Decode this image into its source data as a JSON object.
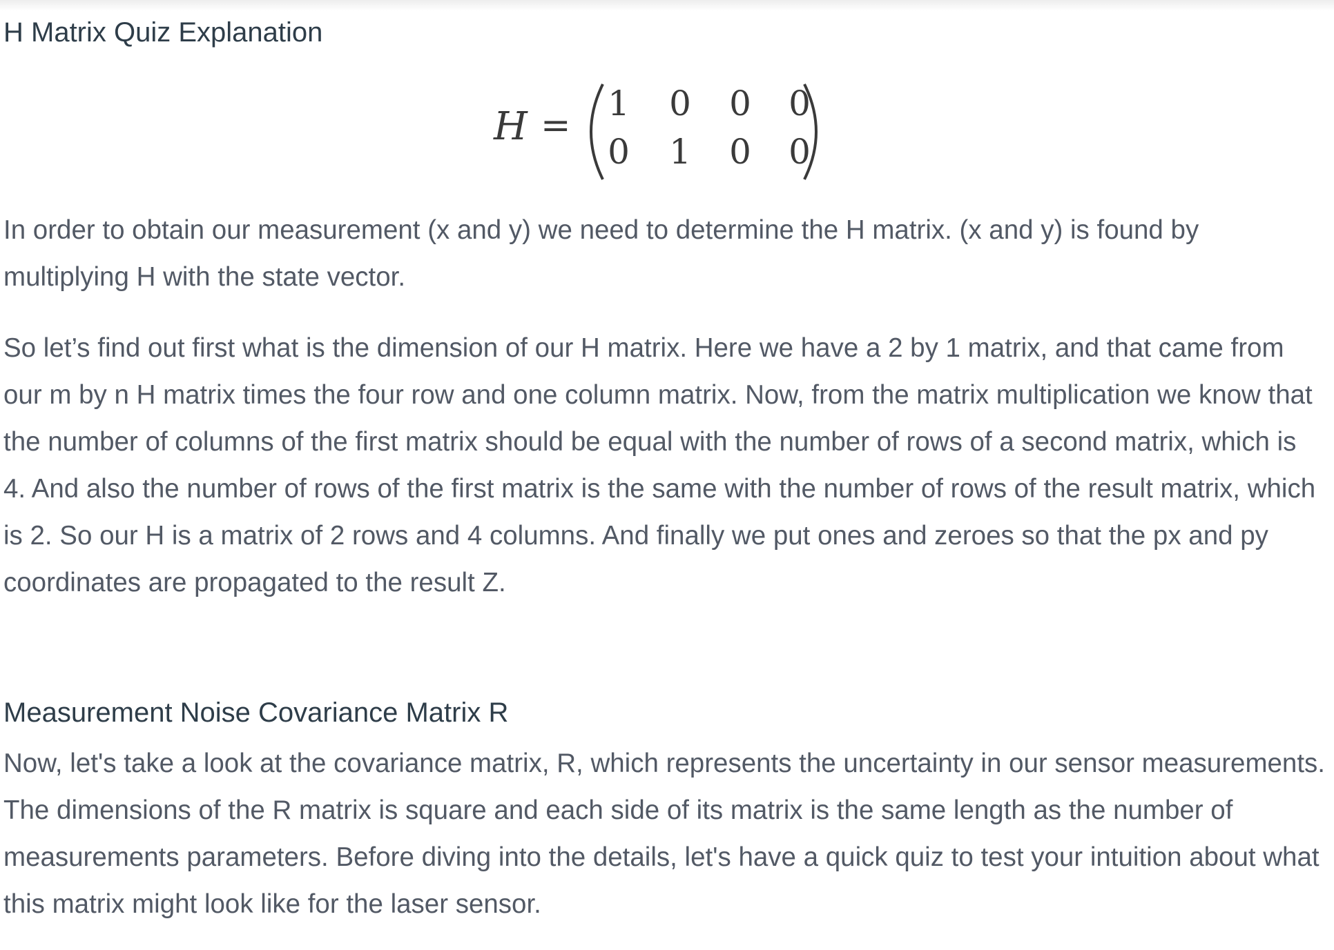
{
  "title": "H Matrix Quiz Explanation",
  "equation": {
    "variable": "H",
    "operator": "=",
    "matrix": [
      [
        "1",
        "0",
        "0",
        "0"
      ],
      [
        "0",
        "1",
        "0",
        "0"
      ]
    ]
  },
  "paragraphs": [
    "In order to obtain our measurement (x and y) we need to determine the H matrix. (x and y) is found by multiplying H with the state vector.",
    "So let’s find out first what is the dimension of our H matrix. Here we have a 2 by 1 matrix, and that came from our m by n H matrix times the four row and one column matrix. Now, from the matrix multiplication we know that the number of columns of the first matrix should be equal with the number of rows of a second matrix, which is 4. And also the number of rows of the first matrix is the same with the number of rows of the result matrix, which is 2. So our H is a matrix of 2 rows and 4 columns. And finally we put ones and zeroes so that the px and py coordinates are propagated to the result Z."
  ],
  "section": {
    "heading": "Measurement Noise Covariance Matrix R",
    "paragraph": "Now, let's take a look at the covariance matrix, R, which represents the uncertainty in our sensor measurements. The dimensions of the R matrix is square and each side of its matrix is the same length as the number of measurements parameters. Before diving into the details, let's have a quick quiz to test your intuition about what this matrix might look like for the laser sensor."
  }
}
